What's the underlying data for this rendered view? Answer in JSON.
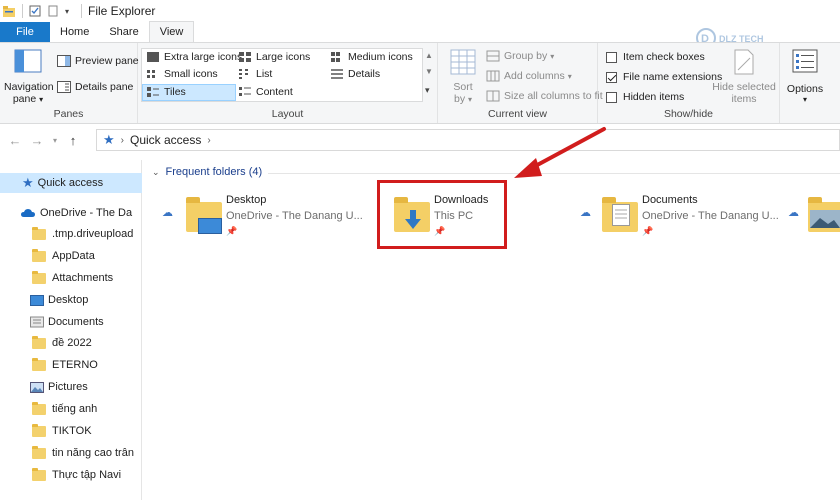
{
  "window": {
    "title": "File Explorer"
  },
  "tabs": [
    {
      "label": "File"
    },
    {
      "label": "Home"
    },
    {
      "label": "Share"
    },
    {
      "label": "View"
    }
  ],
  "ribbon": {
    "panes": {
      "nav_pane_line1": "Navigation",
      "nav_pane_line2": "pane",
      "preview": "Preview pane",
      "details": "Details pane",
      "label": "Panes"
    },
    "layout": {
      "extra_large": "Extra large icons",
      "large": "Large icons",
      "medium": "Medium icons",
      "small": "Small icons",
      "list": "List",
      "details": "Details",
      "tiles": "Tiles",
      "content": "Content",
      "label": "Layout"
    },
    "current_view": {
      "sort_line1": "Sort",
      "sort_line2": "by",
      "group_by": "Group by",
      "add_columns": "Add columns",
      "size_all": "Size all columns to fit",
      "label": "Current view"
    },
    "show_hide": {
      "item_check": "Item check boxes",
      "file_ext": "File name extensions",
      "hidden": "Hidden items",
      "hide_selected_line1": "Hide selected",
      "hide_selected_line2": "items",
      "label": "Show/hide",
      "item_check_checked": false,
      "file_ext_checked": true,
      "hidden_checked": false
    },
    "options": {
      "label": "Options"
    }
  },
  "address": {
    "path": "Quick access"
  },
  "sidebar": {
    "items": [
      {
        "label": "Quick access",
        "icon": "star-icon"
      },
      {
        "label": "OneDrive - The Da",
        "icon": "onedrive-icon"
      },
      {
        "label": ".tmp.driveupload",
        "icon": "folder-icon"
      },
      {
        "label": "AppData",
        "icon": "folder-icon"
      },
      {
        "label": "Attachments",
        "icon": "folder-icon"
      },
      {
        "label": "Desktop",
        "icon": "desktop-icon"
      },
      {
        "label": "Documents",
        "icon": "documents-icon"
      },
      {
        "label": "đề 2022",
        "icon": "folder-icon"
      },
      {
        "label": "ETERNO",
        "icon": "folder-icon"
      },
      {
        "label": "Pictures",
        "icon": "pictures-icon"
      },
      {
        "label": "tiếng anh",
        "icon": "folder-icon"
      },
      {
        "label": "TIKTOK",
        "icon": "folder-icon"
      },
      {
        "label": "tin năng cao trân",
        "icon": "folder-icon"
      },
      {
        "label": "Thực tập Navi",
        "icon": "folder-icon"
      }
    ]
  },
  "content": {
    "section_title": "Frequent folders (4)",
    "folders": [
      {
        "name": "Desktop",
        "location": "OneDrive - The Danang U..."
      },
      {
        "name": "Downloads",
        "location": "This PC"
      },
      {
        "name": "Documents",
        "location": "OneDrive - The Danang U..."
      }
    ]
  },
  "watermark": {
    "text": "DLZ TECH"
  },
  "colors": {
    "file_tab": "#1979ca",
    "highlight": "#d11d1d",
    "selection": "#cde8ff",
    "folder": "#f4cf66"
  }
}
